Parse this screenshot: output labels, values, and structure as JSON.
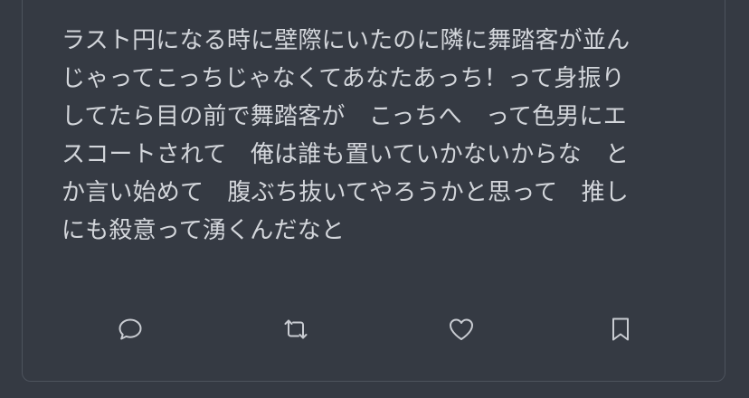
{
  "post": {
    "lines": [
      "ラスト円になる時に壁際にいたのに隣に舞踏客が並ん",
      "じゃってこっちじゃなくてあなたあっち！って身振り",
      "してたら目の前で舞踏客が　こっちへ　って色男にエ",
      "スコートされて　俺は誰も置いていかないからな　と",
      "か言い始めて　腹ぶち抜いてやろうかと思って　推し",
      "にも殺意って湧くんだなと"
    ]
  },
  "actions": {
    "reply_icon": "reply-speech-bubble-icon",
    "repost_icon": "repost-arrows-icon",
    "like_icon": "heart-icon",
    "bookmark_icon": "bookmark-icon",
    "icon_color": "#c9ccd2"
  },
  "theme": {
    "background": "#353a43",
    "border": "#4d535d",
    "text": "#d3d6db"
  }
}
